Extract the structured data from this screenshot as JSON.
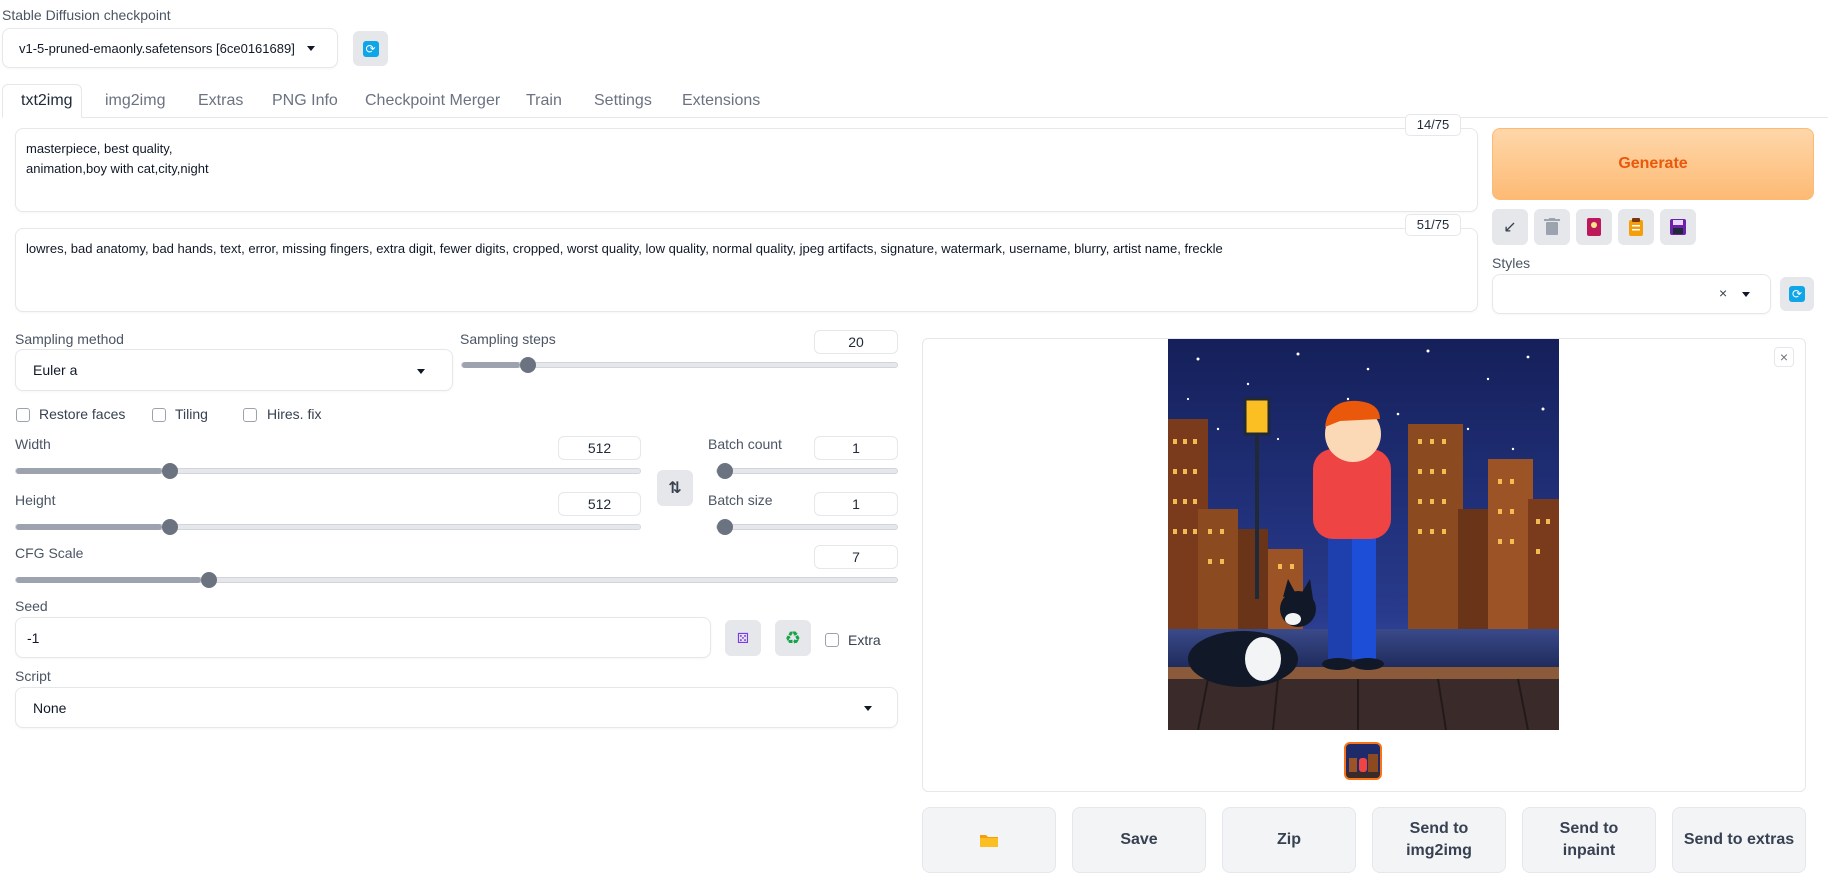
{
  "checkpoint": {
    "label": "Stable Diffusion checkpoint",
    "value": "v1-5-pruned-emaonly.safetensors [6ce0161689]"
  },
  "tabs": [
    {
      "label": "txt2img",
      "active": true
    },
    {
      "label": "img2img"
    },
    {
      "label": "Extras"
    },
    {
      "label": "PNG Info"
    },
    {
      "label": "Checkpoint Merger"
    },
    {
      "label": "Train"
    },
    {
      "label": "Settings"
    },
    {
      "label": "Extensions"
    }
  ],
  "prompt": {
    "text": "masterpiece, best quality,\nanimation,boy with cat,city,night",
    "counter": "14/75"
  },
  "negative_prompt": {
    "text": "lowres, bad anatomy, bad hands, text, error, missing fingers, extra digit, fewer digits, cropped, worst quality, low quality, normal quality, jpeg artifacts, signature, watermark, username, blurry, artist name, freckle",
    "counter": "51/75"
  },
  "generate": {
    "label": "Generate"
  },
  "styles": {
    "label": "Styles",
    "value": "",
    "clear_glyph": "×"
  },
  "sampling_method": {
    "label": "Sampling method",
    "value": "Euler a"
  },
  "sampling_steps": {
    "label": "Sampling steps",
    "value": "20",
    "fraction": 0.133
  },
  "checkboxes": {
    "restore_faces": "Restore faces",
    "tiling": "Tiling",
    "hires_fix": "Hires. fix"
  },
  "width": {
    "label": "Width",
    "value": "512",
    "fraction": 0.234
  },
  "height": {
    "label": "Height",
    "value": "512",
    "fraction": 0.234
  },
  "batch_count": {
    "label": "Batch count",
    "value": "1",
    "fraction": 0.0
  },
  "batch_size": {
    "label": "Batch size",
    "value": "1",
    "fraction": 0.0
  },
  "cfg_scale": {
    "label": "CFG Scale",
    "value": "7",
    "fraction": 0.21
  },
  "seed": {
    "label": "Seed",
    "value": "-1",
    "extra_label": "Extra"
  },
  "script": {
    "label": "Script",
    "value": "None"
  },
  "output_buttons": {
    "folder_icon": "folder-icon",
    "save": "Save",
    "zip": "Zip",
    "send_img2img": "Send to img2img",
    "send_inpaint": "Send to inpaint",
    "send_extras": "Send to extras"
  },
  "colors": {
    "generate_text": "#ea580c",
    "refresh_icon": "#0ea5e9",
    "selected_thumb_border": "#f97316"
  }
}
